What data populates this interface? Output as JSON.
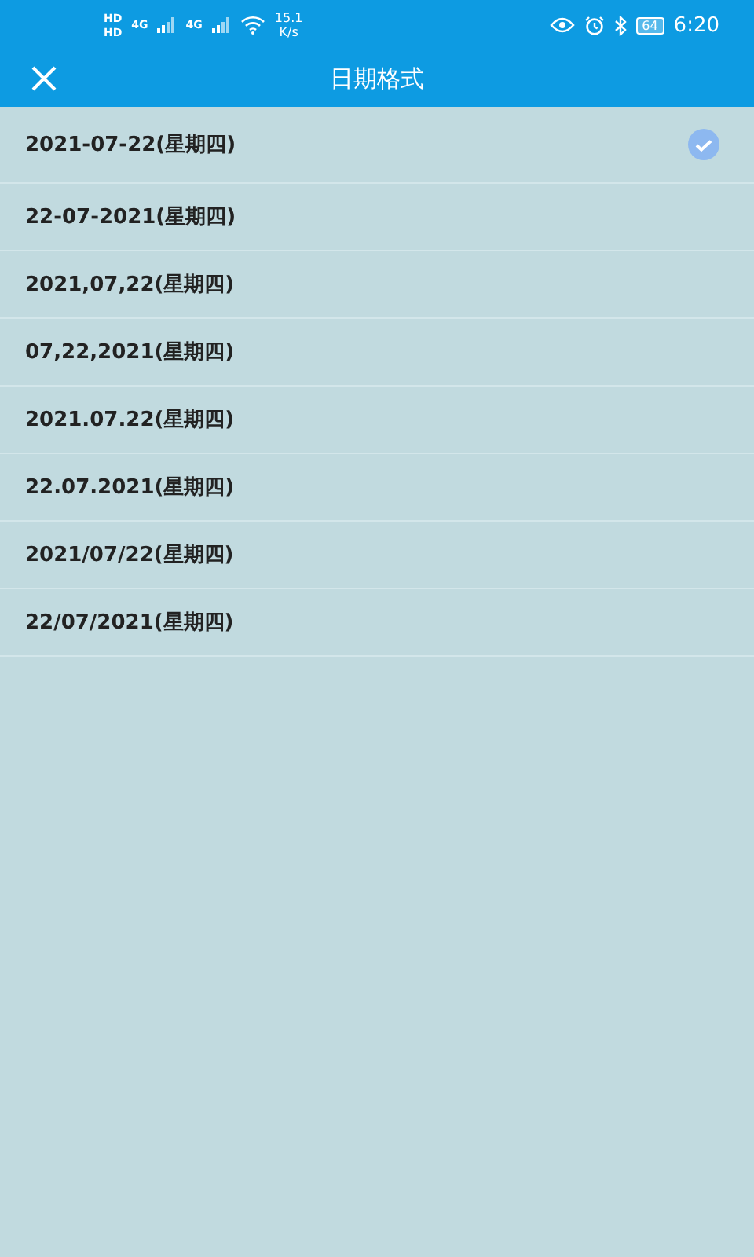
{
  "status_bar": {
    "sim_labels": [
      "HD",
      "HD"
    ],
    "network_labels": [
      "4G",
      "4G"
    ],
    "speed": "15.1",
    "speed_unit": "K/s",
    "battery": "64",
    "time": "6:20"
  },
  "header": {
    "title": "日期格式"
  },
  "formats": [
    {
      "label": "2021-07-22(星期四)",
      "selected": true
    },
    {
      "label": "22-07-2021(星期四)",
      "selected": false
    },
    {
      "label": "2021,07,22(星期四)",
      "selected": false
    },
    {
      "label": "07,22,2021(星期四)",
      "selected": false
    },
    {
      "label": "2021.07.22(星期四)",
      "selected": false
    },
    {
      "label": "22.07.2021(星期四)",
      "selected": false
    },
    {
      "label": "2021/07/22(星期四)",
      "selected": false
    },
    {
      "label": "22/07/2021(星期四)",
      "selected": false
    }
  ]
}
